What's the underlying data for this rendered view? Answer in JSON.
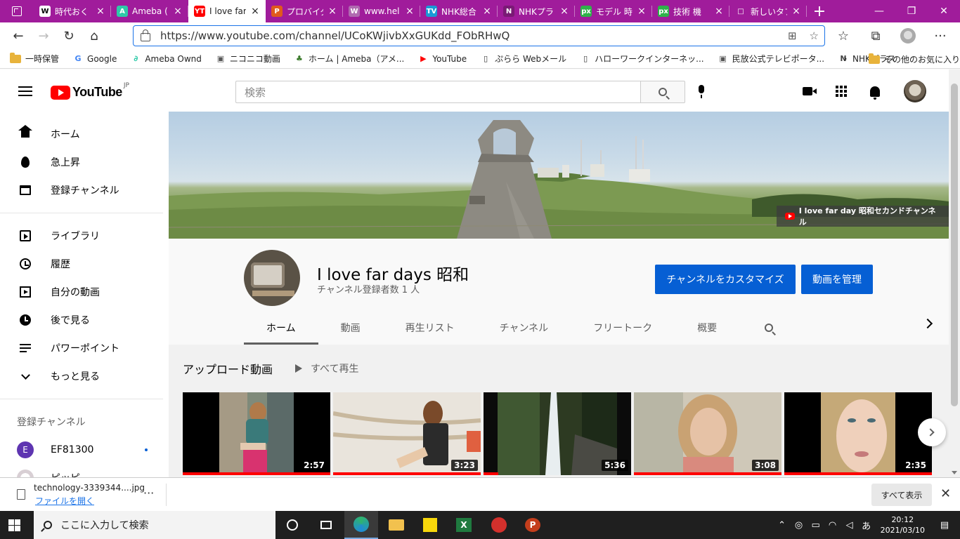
{
  "browser": {
    "tabs": [
      {
        "label": "時代おく",
        "favicon": "W",
        "color": "#ffffff",
        "fg": "#000000",
        "active": false
      },
      {
        "label": "Ameba (",
        "favicon": "A",
        "color": "#2dc9a8",
        "fg": "#ffffff",
        "active": false
      },
      {
        "label": "I love far",
        "favicon": "YT",
        "color": "#ff0000",
        "fg": "#ffffff",
        "active": true
      },
      {
        "label": "プロバイダ",
        "favicon": "P",
        "color": "#e05a1c",
        "fg": "#ffffff",
        "active": false
      },
      {
        "label": "www.hel",
        "favicon": "W",
        "color": "#b06ab0",
        "fg": "#ffffff",
        "active": false
      },
      {
        "label": "NHK総合",
        "favicon": "TV",
        "color": "#1a9ad6",
        "fg": "#ffffff",
        "active": false
      },
      {
        "label": "NHKプラ",
        "favicon": "N",
        "color": "#7a1a75",
        "fg": "#ffffff",
        "active": false
      },
      {
        "label": "モデル 時",
        "favicon": "px",
        "color": "#2fb24a",
        "fg": "#ffffff",
        "active": false
      },
      {
        "label": "技術 機",
        "favicon": "px",
        "color": "#2fb24a",
        "fg": "#ffffff",
        "active": false
      },
      {
        "label": "新しいタブ",
        "favicon": "□",
        "color": "#a01c9b",
        "fg": "#ffffff",
        "active": false
      }
    ],
    "url": "https://www.youtube.com/channel/UCoKWjivbXxGUKdd_FObRHwQ",
    "bookmarks": [
      {
        "label": "一時保管",
        "icon": "folder"
      },
      {
        "label": "Google",
        "icon": "G"
      },
      {
        "label": "Ameba Ownd",
        "icon": "A"
      },
      {
        "label": "ニコニコ動画",
        "icon": "TV"
      },
      {
        "label": "ホーム | Ameba（アメ...",
        "icon": "ameba"
      },
      {
        "label": "YouTube",
        "icon": "yt"
      },
      {
        "label": "ぷらら Webメール",
        "icon": "page"
      },
      {
        "label": "ハローワークインターネッ...",
        "icon": "page"
      },
      {
        "label": "民放公式テレビポータ...",
        "icon": "TV"
      },
      {
        "label": "NHKプラス",
        "icon": "N"
      }
    ],
    "other_bookmarks": "その他のお気に入り"
  },
  "youtube": {
    "logo_text": "YouTube",
    "logo_region": "JP",
    "search_placeholder": "検索",
    "sidebar": {
      "primary": [
        {
          "label": "ホーム",
          "icon": "home-icon"
        },
        {
          "label": "急上昇",
          "icon": "trending-icon"
        },
        {
          "label": "登録チャンネル",
          "icon": "subscriptions-icon"
        }
      ],
      "secondary": [
        {
          "label": "ライブラリ",
          "icon": "library-icon"
        },
        {
          "label": "履歴",
          "icon": "history-icon"
        },
        {
          "label": "自分の動画",
          "icon": "my-videos-icon"
        },
        {
          "label": "後で見る",
          "icon": "watch-later-icon"
        },
        {
          "label": "パワーポイント",
          "icon": "playlist-icon"
        },
        {
          "label": "もっと見る",
          "icon": "chevron-down-icon"
        }
      ],
      "subscriptions_heading": "登録チャンネル",
      "subscriptions": [
        {
          "label": "EF81300",
          "initial": "E",
          "color": "#5e35b1",
          "new": true
        },
        {
          "label": "ピッピ",
          "initial": "",
          "color": "#e0d8dc",
          "new": false
        }
      ]
    },
    "channel": {
      "banner_label": "I love far day 昭和セカンドチャンネル",
      "name": "I love far days 昭和",
      "subscribers": "チャンネル登録者数 1 人",
      "customize_button": "チャンネルをカスタマイズ",
      "manage_button": "動画を管理",
      "tabs": [
        "ホーム",
        "動画",
        "再生リスト",
        "チャンネル",
        "フリートーク",
        "概要"
      ],
      "active_tab": "ホーム"
    },
    "uploads": {
      "title": "アップロード動画",
      "play_all": "すべて再生",
      "videos": [
        {
          "duration": "2:57",
          "progress": 1.0
        },
        {
          "duration": "3:23",
          "progress": 1.0
        },
        {
          "duration": "5:36",
          "progress": 0.1
        },
        {
          "duration": "3:08",
          "progress": 1.0
        },
        {
          "duration": "2:35",
          "progress": 1.0
        }
      ]
    }
  },
  "download": {
    "filename": "technology-3339344....jpg",
    "open_link": "ファイルを開く",
    "show_all": "すべて表示"
  },
  "taskbar": {
    "search_placeholder": "ここに入力して検索",
    "time": "20:12",
    "date": "2021/03/10",
    "ime": "あ"
  }
}
